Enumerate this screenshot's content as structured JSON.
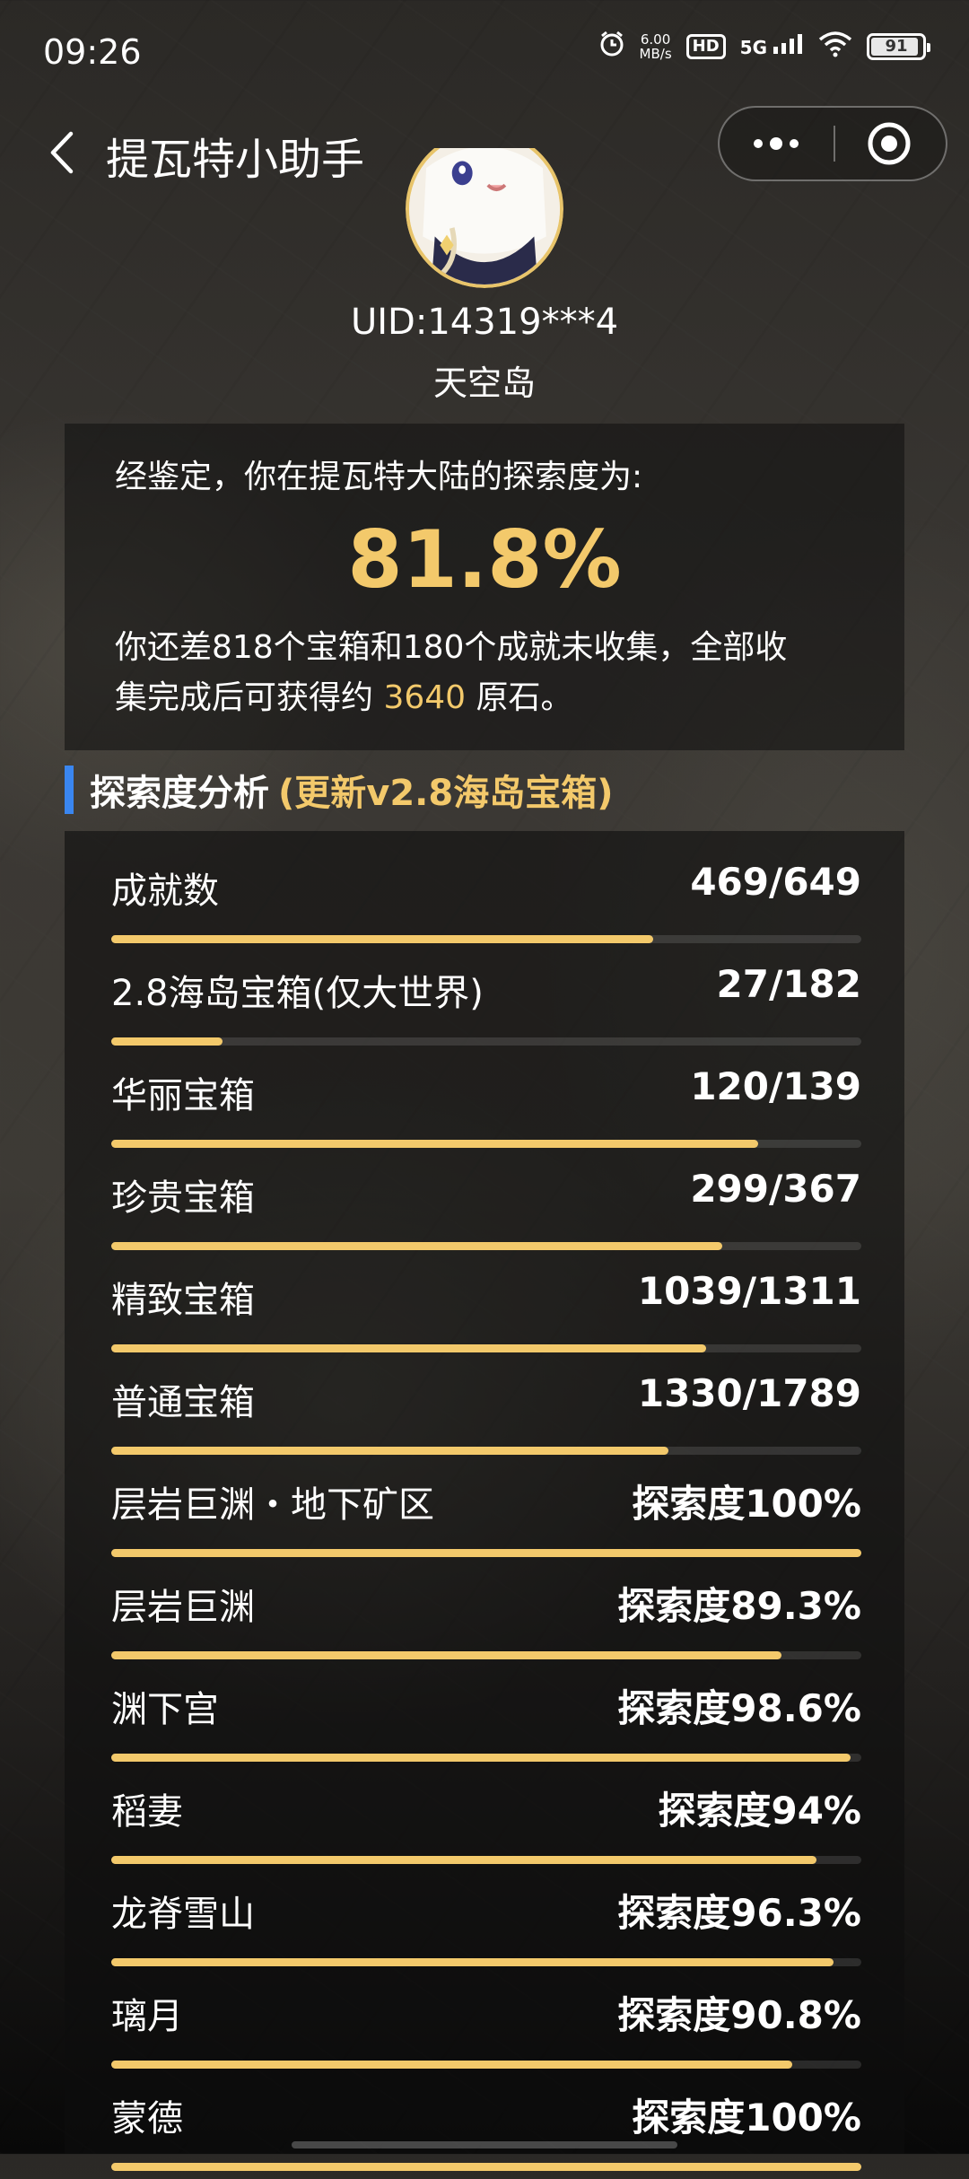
{
  "status_bar": {
    "time": "09:26",
    "net_speed_value": "6.00",
    "net_speed_unit": "MB/s",
    "hd": "HD",
    "signal": "5G",
    "battery": "91"
  },
  "header": {
    "title": "提瓦特小助手"
  },
  "profile": {
    "uid": "UID:14319***4",
    "region": "天空岛"
  },
  "summary": {
    "intro": "经鉴定，你在提瓦特大陆的探索度为:",
    "percent": "81.8%",
    "desc_line1": "你还差818个宝箱和180个成就未收集，全部收",
    "desc_line2_pre": "集完成后可获得约 ",
    "primogems": "3640",
    "desc_line2_post": " 原石。"
  },
  "section": {
    "title": "探索度分析",
    "subtitle": "(更新v2.8海岛宝箱)"
  },
  "rows": [
    {
      "label": "成就数",
      "value": "469/649",
      "progress": 0.723
    },
    {
      "label": "2.8海岛宝箱(仅大世界)",
      "value": "27/182",
      "progress": 0.148
    },
    {
      "label": "华丽宝箱",
      "value": "120/139",
      "progress": 0.863
    },
    {
      "label": "珍贵宝箱",
      "value": "299/367",
      "progress": 0.815
    },
    {
      "label": "精致宝箱",
      "value": "1039/1311",
      "progress": 0.793
    },
    {
      "label": "普通宝箱",
      "value": "1330/1789",
      "progress": 0.743
    },
    {
      "label": "层岩巨渊・地下矿区",
      "value": "探索度100%",
      "progress": 1.0
    },
    {
      "label": "层岩巨渊",
      "value": "探索度89.3%",
      "progress": 0.893
    },
    {
      "label": "渊下宫",
      "value": "探索度98.6%",
      "progress": 0.986
    },
    {
      "label": "稻妻",
      "value": "探索度94%",
      "progress": 0.94
    },
    {
      "label": "龙脊雪山",
      "value": "探索度96.3%",
      "progress": 0.963
    },
    {
      "label": "璃月",
      "value": "探索度90.8%",
      "progress": 0.908
    },
    {
      "label": "蒙德",
      "value": "探索度100%",
      "progress": 1.0
    }
  ],
  "colors": {
    "accent_gold": "#f3c96b",
    "section_bar_blue": "#3a86f0"
  },
  "icons": {
    "back": "chevron-left-icon",
    "more": "more-dots-icon",
    "close": "target-close-icon"
  }
}
